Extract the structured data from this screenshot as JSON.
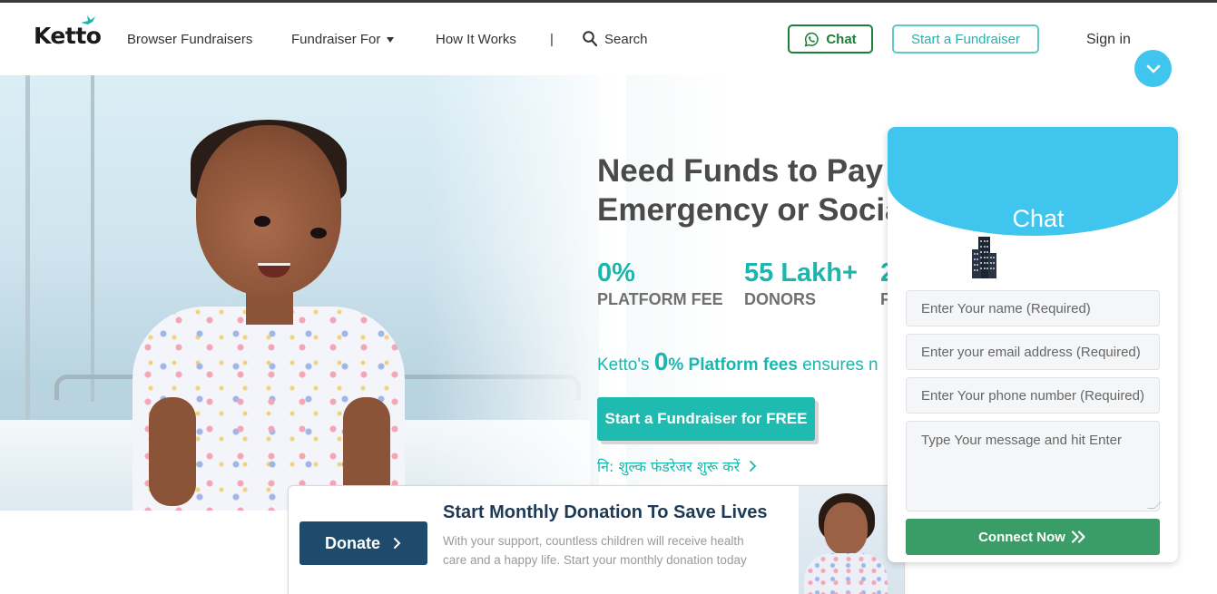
{
  "header": {
    "logo": "Ketto",
    "nav": {
      "browse": "Browser Fundraisers",
      "fundraiser_for": "Fundraiser For",
      "how_it_works": "How It Works",
      "separator": "|",
      "search": "Search"
    },
    "chat_button": "Chat",
    "start_fundraiser_button": "Start a Fundraiser",
    "sign_in": "Sign in"
  },
  "hero": {
    "title_line1": "Need Funds to Pay",
    "title_line2": "Emergency or Socia",
    "stats": [
      {
        "value": "0%",
        "label": "PLATFORM FEE"
      },
      {
        "value": "55 Lakh+",
        "label": "DONORS"
      },
      {
        "value": "2",
        "label": "F"
      }
    ],
    "tagline": {
      "prefix": "Ketto's ",
      "zero": "0",
      "bold": "% Platform fees",
      "suffix": " ensures n"
    },
    "cta_button": "Start a Fundraiser for FREE",
    "hindi_link": "नि: शुल्क फंडरेजर शुरू करें"
  },
  "donation_card": {
    "button": "Donate",
    "title": "Start Monthly Donation To Save Lives",
    "text": "With your support, countless children will receive health care and a happy life. Start your monthly donation today"
  },
  "chat_widget": {
    "title": "Chat",
    "name_placeholder": "Enter Your name (Required)",
    "email_placeholder": "Enter your email address (Required)",
    "phone_placeholder": "Enter Your phone number (Required)",
    "message_placeholder": "Type Your message and hit Enter",
    "connect_button": "Connect Now"
  },
  "colors": {
    "brand_teal": "#1bb6ad",
    "chat_blue": "#40c6ee",
    "whatsapp_green": "#1a7f37",
    "connect_green": "#3a9d68",
    "donate_navy": "#1e4a6b"
  },
  "icons": [
    "bird-icon",
    "chevron-down-icon",
    "search-icon",
    "whatsapp-icon",
    "chevron-right-icon",
    "building-icon",
    "double-chevron-right-icon"
  ]
}
